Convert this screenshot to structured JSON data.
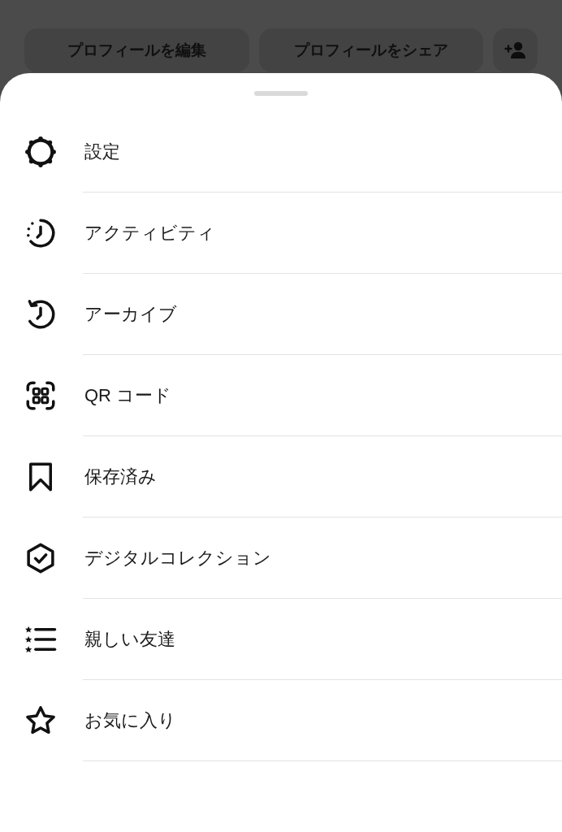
{
  "header": {
    "buttons": [
      {
        "label": "プロフィールを編集"
      },
      {
        "label": "プロフィールをシェア"
      }
    ]
  },
  "sheet": {
    "items": [
      {
        "label": "設定"
      },
      {
        "label": "アクティビティ"
      },
      {
        "label": "アーカイブ"
      },
      {
        "label": "QR コード"
      },
      {
        "label": "保存済み"
      },
      {
        "label": "デジタルコレクション"
      },
      {
        "label": "親しい友達"
      },
      {
        "label": "お気に入り"
      }
    ]
  }
}
